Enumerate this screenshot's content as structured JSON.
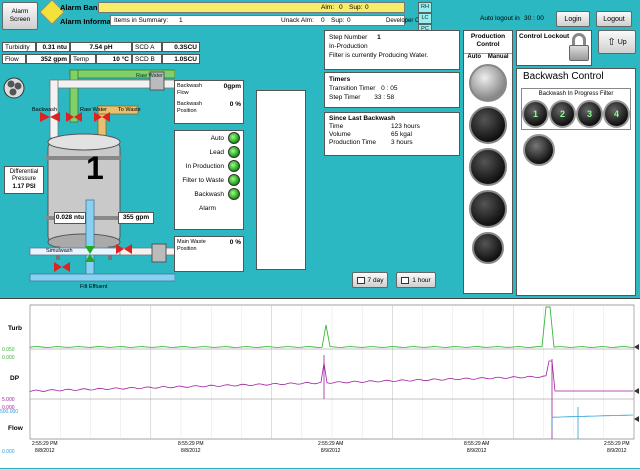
{
  "top_bar": {
    "alarm_screen_label": "Alarm Screen",
    "alarm_banner_label": "Alarm Banner",
    "alarm_information_label": "Alarm Information",
    "alm_label": "Alm:",
    "alm_value": "0",
    "sup_label": "Sup:",
    "sup_value": "0",
    "items_in_summary_label": "Items in Summary:",
    "items_in_summary_value": "1",
    "unack_alm_label": "Unack Alm:",
    "unack_alm_value": "0",
    "unack_sup_label": "Sup:",
    "unack_sup_value": "0",
    "developer_client": "Developer Client",
    "auto_logout_label": "Auto logout in",
    "auto_logout_value": "30 : 00",
    "login_label": "Login",
    "logout_label": "Logout",
    "status_letters": [
      "RH",
      "LC",
      "PC"
    ]
  },
  "process": {
    "turbidity_label": "Turbidity",
    "turbidity_value": "0.31 ntu",
    "ph_value": "7.54 pH",
    "scd_a_label": "SCD A",
    "scd_a_value": "0.3SCU",
    "flow_label": "Flow",
    "flow_value": "352 gpm",
    "temp_label": "Temp",
    "temp_value": "10 °C",
    "scd_b_label": "SCD B",
    "scd_b_value": "1.0SCU",
    "raw_water_label": "Raw Water",
    "backwash_label": "Backwash",
    "raw_water_valve_label": "Raw Water",
    "to_waste_label": "To Waste",
    "filter_number": "1",
    "diff_pressure_label": "Differential Pressure",
    "diff_pressure_value": "1.17 PSI",
    "effluent_turb": "0.028 ntu",
    "effluent_flow": "355 gpm",
    "drain_label": "Simulwash",
    "filt_label": "Filt Effluent",
    "backwash_flow_label": "Backwash Flow",
    "backwash_flow_value": "0gpm",
    "backwash_position_label": "Backwash Position",
    "backwash_position_value": "0 %",
    "main_waste_label": "Main Waste Position",
    "main_waste_value": "0 %",
    "status_items": [
      "Auto",
      "Lead",
      "In Production",
      "Filter to Waste",
      "Backwash"
    ],
    "alarm_label": "Alarm"
  },
  "step": {
    "step_number_label": "Step Number",
    "step_number_value": "1",
    "state": "In-Production",
    "message": "Filter is currently Producing Water."
  },
  "timers": {
    "title": "Timers",
    "transition_label": "Transition Timer",
    "transition_value": "0 : 05",
    "step_label": "Step Timer",
    "step_value": "33 : 58"
  },
  "since_backwash": {
    "title": "Since Last Backwash",
    "time_label": "Time",
    "time_value": "123 hours",
    "volume_label": "Volume",
    "volume_value": "65 kgal",
    "production_label": "Production Time",
    "production_value": "3 hours"
  },
  "trend_buttons": {
    "day_label": "7 day",
    "hour_label": "1 hour"
  },
  "production_control": {
    "title": "Production Control",
    "auto_label": "Auto",
    "manual_label": "Manual"
  },
  "control_lockout": {
    "title": "Control Lockout",
    "up_label": "Up"
  },
  "backwash_control": {
    "title": "Backwash Control",
    "subtitle": "Backwash In Progress Filter",
    "filters": [
      "1",
      "2",
      "3",
      "4"
    ]
  },
  "trend": {
    "labels": [
      "Turb",
      "DP",
      "Flow"
    ],
    "scale_values": [
      "0.050",
      "0.000",
      "5.000",
      "0.000",
      "500.000",
      "0.000"
    ],
    "times": [
      "2:55:29 PM",
      "8:55:29 PM",
      "2:55:29 AM",
      "8:55:29 AM",
      "2:55:29 PM"
    ],
    "dates": [
      "8/8/2012",
      "8/8/2012",
      "8/9/2012",
      "8/9/2012",
      "8/9/2012"
    ],
    "colors": {
      "turb": "#3cb83c",
      "dp": "#a01fa0",
      "flow": "#2aa0d8"
    }
  }
}
